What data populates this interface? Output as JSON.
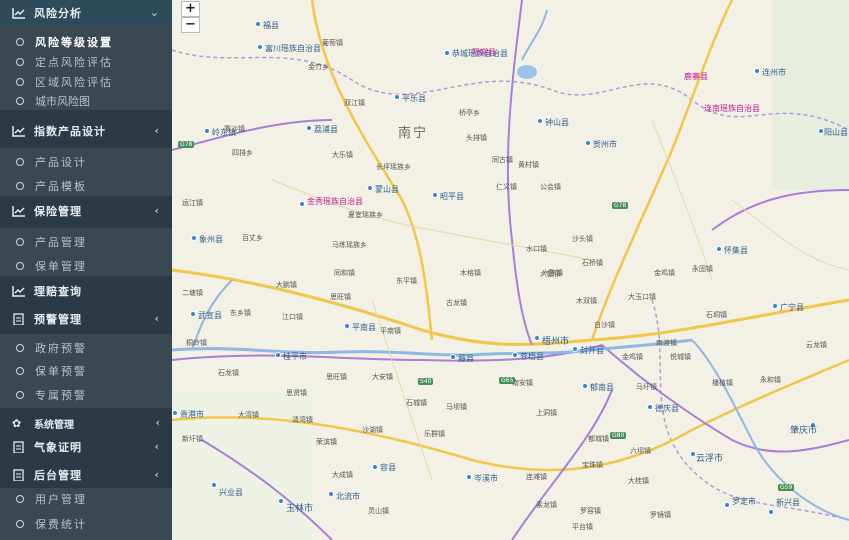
{
  "sidebar": {
    "groups": [
      {
        "label": "风险分析",
        "arrow": "⌄",
        "items": [
          "风险等级设置",
          "定点风险评估",
          "区域风险评估",
          "城市风险图"
        ]
      },
      {
        "label": "指数产品设计",
        "arrow": "‹",
        "items": [
          "产品设计",
          "产品模板"
        ]
      },
      {
        "label": "保险管理",
        "arrow": "‹",
        "items": [
          "产品管理",
          "保单管理"
        ]
      },
      {
        "label": "理赔查询",
        "arrow": "",
        "items": []
      },
      {
        "label": "预警管理",
        "arrow": "‹",
        "items": [
          "政府预警",
          "保单预警",
          "专属预警"
        ]
      },
      {
        "label": "系统管理",
        "arrow": "‹",
        "items": []
      },
      {
        "label": "气象证明",
        "arrow": "‹",
        "items": []
      },
      {
        "label": "后台管理",
        "arrow": "‹",
        "items": [
          "用户管理",
          "保费统计"
        ]
      }
    ]
  },
  "map": {
    "zoom_in": "+",
    "zoom_out": "−",
    "region_label": "南宁",
    "cities": [
      "福县",
      "富川瑶族自治县",
      "恭城瑶族自治县",
      "钟山县",
      "贺州市",
      "平乐县",
      "昭平县",
      "蒙山县",
      "金秀瑶族自治县",
      "象州县",
      "武宣县",
      "梧州市",
      "藤县",
      "岑溪市",
      "苍梧县",
      "封开县",
      "郁南县",
      "德庆县",
      "兴业县",
      "玉林市",
      "北流市",
      "容县",
      "桂平市",
      "平南县",
      "贵港市",
      "罗定市",
      "云浮市",
      "肇庆市",
      "新兴县",
      "怀集县",
      "广宁县",
      "阳山县",
      "连南瑶族自治县",
      "连州市",
      "鹿寨县",
      "阳朔县",
      "荔浦县",
      "岭东镇"
    ],
    "towns": [
      "葡萄镇",
      "金竹乡",
      "双江镇",
      "桥亭乡",
      "寨沙镇",
      "四排乡",
      "头排镇",
      "大乐镇",
      "百丈乡",
      "运江镇",
      "二塘镇",
      "东乡镇",
      "桐岭镇",
      "石龙镇",
      "大湾镇",
      "新圩镇",
      "长坪瑶族乡",
      "夏宜瑶族乡",
      "马练瑶族乡",
      "同和镇",
      "思旺镇",
      "大鹏镇",
      "江口镇",
      "思旺镇",
      "大安镇",
      "六陈镇",
      "木格镇",
      "古龙镇",
      "东平镇",
      "同古镇",
      "仁义镇",
      "黄村镇",
      "公会镇",
      "水口镇",
      "六堡镇",
      "木双镇",
      "沙头镇",
      "石桥镇",
      "大玉口镇",
      "金鸡镇",
      "永固镇",
      "石垌镇",
      "南渡镇",
      "白沙镇",
      "马圩镇",
      "金鸡镇",
      "悦城镇",
      "播植镇",
      "永和镇",
      "云龙镇",
      "南安镇",
      "上洞镇",
      "都城镇",
      "宝珠镇",
      "大桂镇",
      "六坝镇",
      "罗容镇",
      "连滩镇",
      "素龙镇",
      "平台镇",
      "罗镜镇",
      "石城镇",
      "马坝镇",
      "乐群镇",
      "沙湖镇",
      "大成镇",
      "清湾镇",
      "荣滨镇",
      "思贤镇",
      "平南镇",
      "灵山镇"
    ],
    "highways": [
      "G78",
      "G65",
      "G80",
      "G59",
      "S40",
      "G78"
    ]
  }
}
